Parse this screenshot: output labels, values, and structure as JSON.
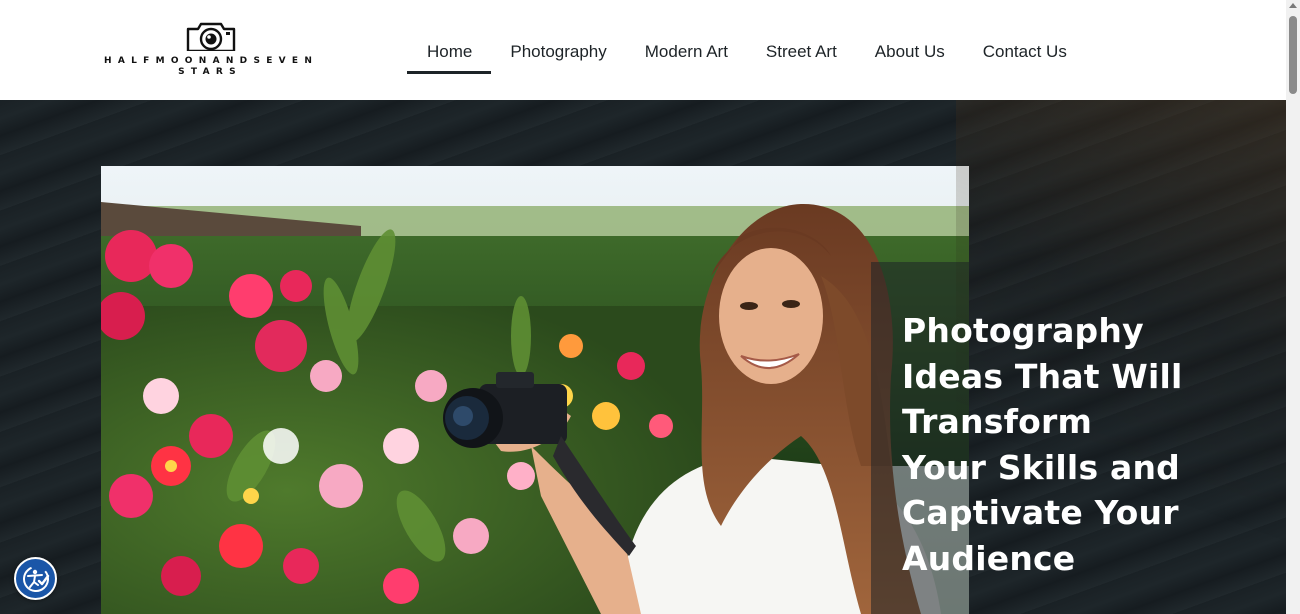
{
  "brand": {
    "line1": "HALFMOONANDSEVEN",
    "line2": "STARS",
    "logo_icon": "camera-icon"
  },
  "nav": {
    "items": [
      {
        "label": "Home",
        "active": true
      },
      {
        "label": "Photography"
      },
      {
        "label": "Modern Art"
      },
      {
        "label": "Street Art"
      },
      {
        "label": "About Us"
      },
      {
        "label": "Contact Us"
      }
    ]
  },
  "hero": {
    "headline_lines": [
      "Photography",
      "Ideas That Will",
      "Transform",
      "Your Skills and",
      "Captivate Your",
      "Audience"
    ],
    "image_subject": "woman-with-camera-in-flower-garden"
  },
  "accessibility": {
    "icon": "accessibility-icon",
    "color": "#1a56a8"
  },
  "colors": {
    "header_bg": "#ffffff",
    "nav_text": "#1d2327",
    "hero_bg": "#1b2226",
    "headline": "#ffffff"
  }
}
